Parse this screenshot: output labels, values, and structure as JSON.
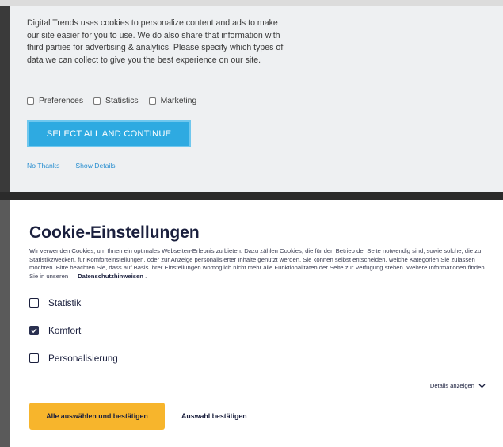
{
  "digital_trends": {
    "body_text": "Digital Trends uses cookies to personalize content and ads to make our site easier for you to use. We do also share that information with third parties for advertising & analytics. Please specify which types of data we can collect to give you the best experience on our site.",
    "options": [
      "Preferences",
      "Statistics",
      "Marketing"
    ],
    "select_all_label": "SELECT ALL AND CONTINUE",
    "no_thanks_label": "No Thanks",
    "show_details_label": "Show Details"
  },
  "cookie_settings": {
    "title": "Cookie-Einstellungen",
    "description": "Wir verwenden Cookies, um Ihnen ein optimales Webseiten-Erlebnis zu bieten. Dazu zählen Cookies, die für den Betrieb der Seite notwendig sind, sowie solche, die zu Statistikzwecken, für Komforteinstellungen, oder zur Anzeige personalisierter Inhalte genutzt werden. Sie können selbst entscheiden, welche Kategorien Sie zulassen möchten. Bitte beachten Sie, dass auf Basis Ihrer Einstellungen womöglich nicht mehr alle Funktionalitäten der Seite zur Verfügung stehen. Weitere Informationen finden Sie in unseren",
    "privacy_link": "→ Datenschutzhinweisen",
    "privacy_suffix": ".",
    "options": [
      {
        "label": "Statistik",
        "checked": false
      },
      {
        "label": "Komfort",
        "checked": true
      },
      {
        "label": "Personalisierung",
        "checked": false
      }
    ],
    "details_label": "Details anzeigen",
    "accept_all_label": "Alle auswählen und bestätigen",
    "confirm_selection_label": "Auswahl bestätigen"
  },
  "colors": {
    "dt_button": "#2eaae1",
    "dt_link": "#2a8fd0",
    "ce_primary": "#f7b52c",
    "ce_text": "#1a1f3d"
  }
}
